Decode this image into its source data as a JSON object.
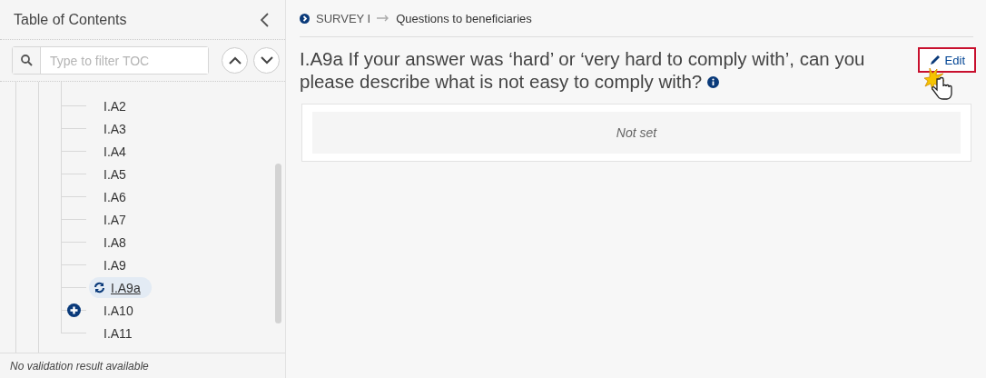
{
  "sidebar": {
    "title": "Table of Contents",
    "filter": {
      "placeholder": "Type to filter TOC"
    },
    "items": [
      {
        "label": "I.A2",
        "kind": "leaf",
        "selected": false
      },
      {
        "label": "I.A3",
        "kind": "leaf",
        "selected": false
      },
      {
        "label": "I.A4",
        "kind": "leaf",
        "selected": false
      },
      {
        "label": "I.A5",
        "kind": "leaf",
        "selected": false
      },
      {
        "label": "I.A6",
        "kind": "leaf",
        "selected": false
      },
      {
        "label": "I.A7",
        "kind": "leaf",
        "selected": false
      },
      {
        "label": "I.A8",
        "kind": "leaf",
        "selected": false
      },
      {
        "label": "I.A9",
        "kind": "leaf",
        "selected": false
      },
      {
        "label": "I.A9a",
        "kind": "leaf",
        "selected": true
      },
      {
        "label": "I.A10",
        "kind": "expandable",
        "selected": false
      },
      {
        "label": "I.A11",
        "kind": "leaf",
        "selected": false
      }
    ],
    "footer": "No validation result available"
  },
  "breadcrumb": [
    "SURVEY I",
    "Questions to beneficiaries"
  ],
  "question": {
    "title": "I.A9a If your answer was ‘hard’ or ‘very hard to comply with’, can you please describe what is not easy to comply with?",
    "edit_label": "Edit",
    "answer": "Not set"
  }
}
